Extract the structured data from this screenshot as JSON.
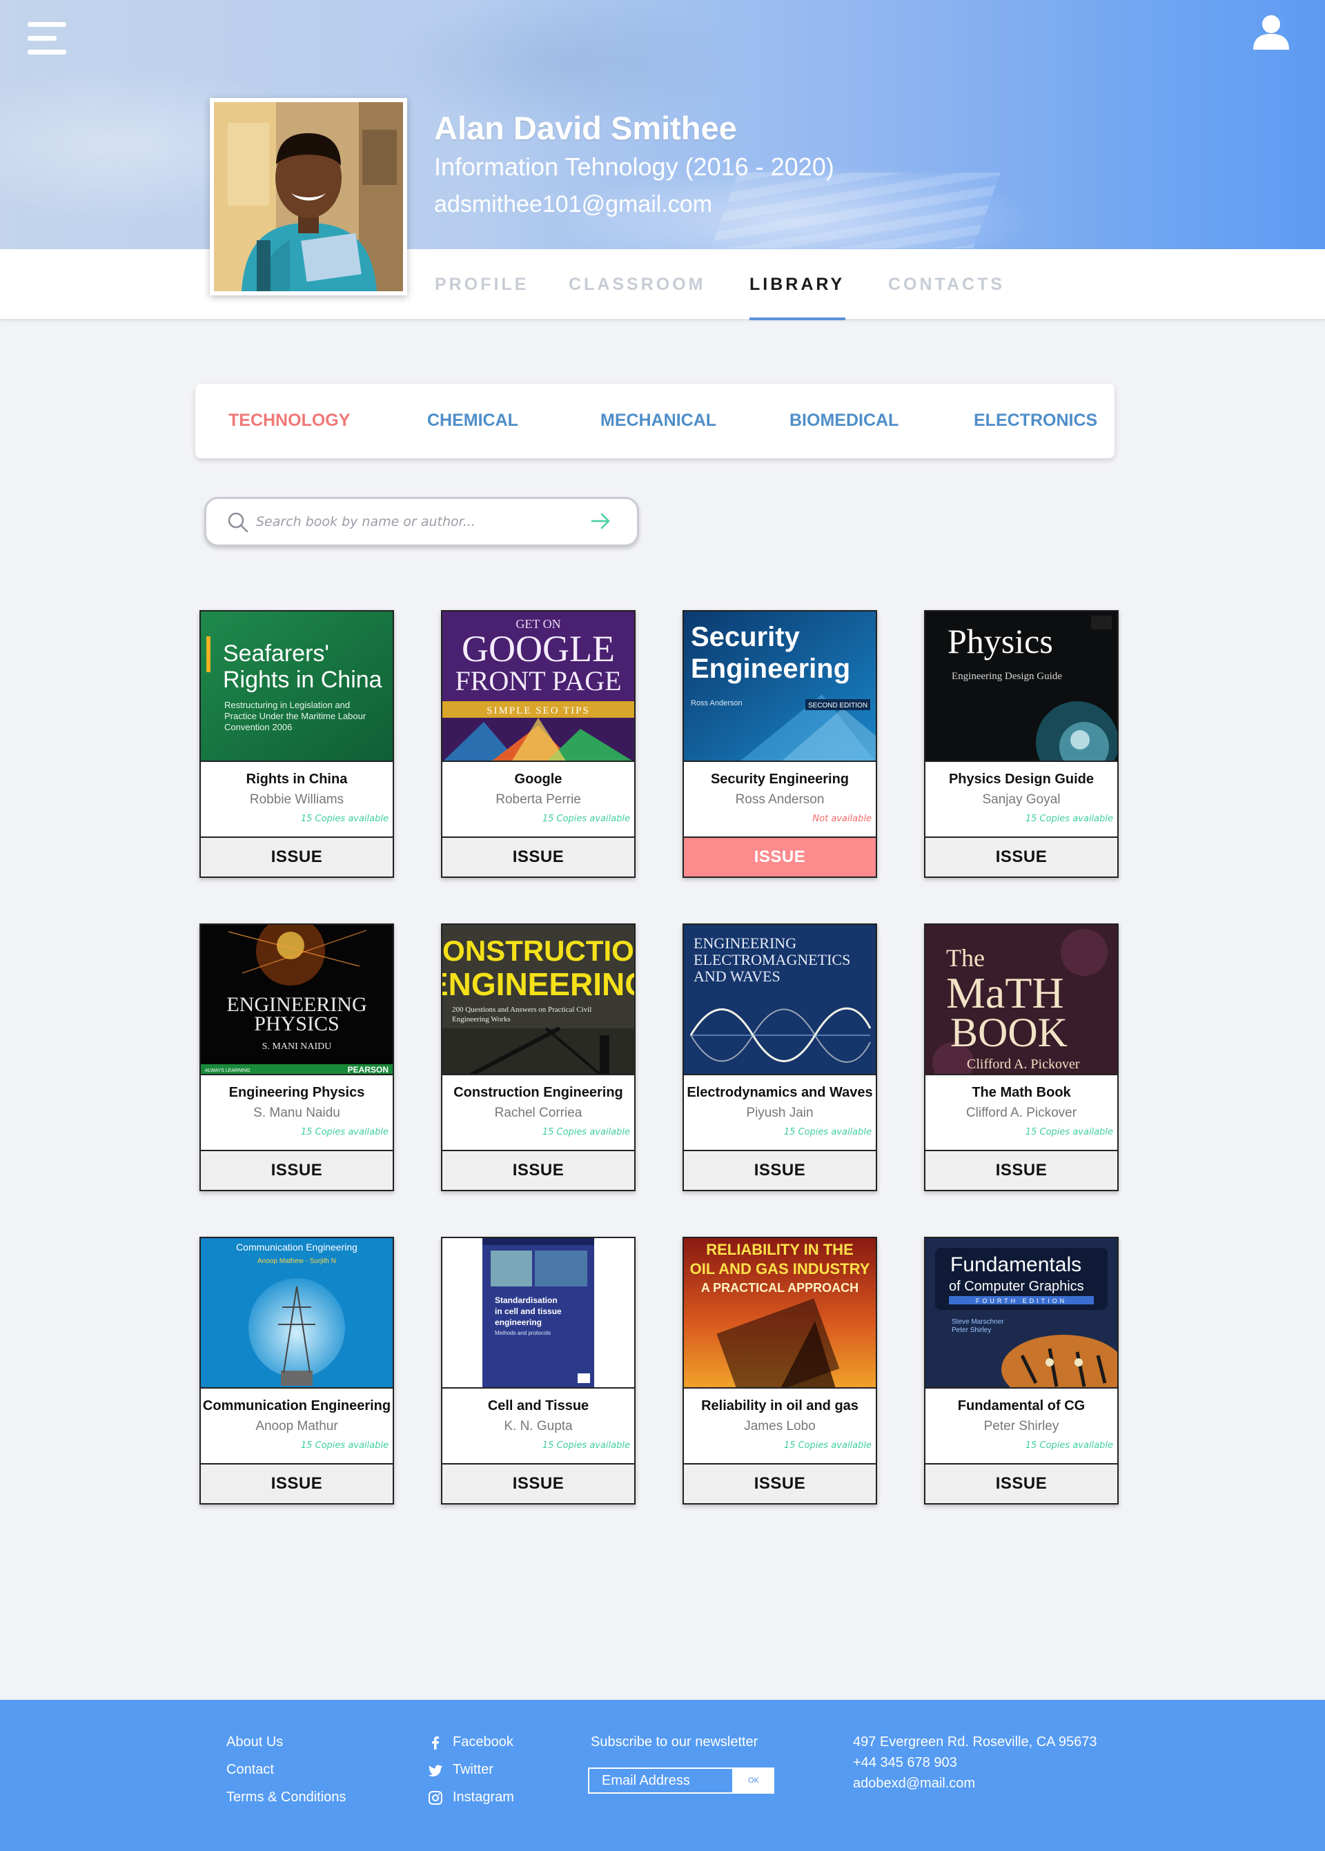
{
  "profile": {
    "name": "Alan David Smithee",
    "course": "Information Tehnology (2016 - 2020)",
    "email": "adsmithee101@gmail.com"
  },
  "tabs": [
    {
      "label": "PROFILE",
      "active": false
    },
    {
      "label": "CLASSROOM",
      "active": false
    },
    {
      "label": "LIBRARY",
      "active": true
    },
    {
      "label": "CONTACTS",
      "active": false
    }
  ],
  "categories": [
    {
      "label": "TECHNOLOGY",
      "active": true
    },
    {
      "label": "CHEMICAL",
      "active": false
    },
    {
      "label": "MECHANICAL",
      "active": false
    },
    {
      "label": "BIOMEDICAL",
      "active": false
    },
    {
      "label": "ELECTRONICS",
      "active": false
    }
  ],
  "search": {
    "placeholder": "Search book by name or author..."
  },
  "books": [
    {
      "title": "Rights in China",
      "author": "Robbie Williams",
      "availability": "15 Copies available",
      "available": true,
      "issue_label": "ISSUE",
      "cover": {
        "lines": [
          "Seafarers'",
          "Rights in China"
        ],
        "sub": [
          "Restructuring in Legislation and",
          "Practice Under the Maritime Labour",
          "Convention 2006"
        ]
      }
    },
    {
      "title": "Google",
      "author": "Roberta Perrie",
      "availability": "15 Copies available",
      "available": true,
      "issue_label": "ISSUE",
      "cover": {
        "top": "GET ON",
        "lines": [
          "GOOGLE",
          "FRONT PAGE"
        ],
        "band": "SIMPLE SEO TIPS"
      }
    },
    {
      "title": "Security Engineering",
      "author": "Ross Anderson",
      "availability": "Not available",
      "available": false,
      "issue_label": "ISSUE",
      "cover": {
        "lines": [
          "Security",
          "Engineering"
        ],
        "author": "Ross Anderson",
        "edition": "SECOND EDITION"
      }
    },
    {
      "title": "Physics Design Guide",
      "author": "Sanjay Goyal",
      "availability": "15 Copies available",
      "available": true,
      "issue_label": "ISSUE",
      "cover": {
        "lines": [
          "Physics"
        ],
        "sub": "Engineering Design Guide"
      }
    },
    {
      "title": "Engineering Physics",
      "author": "S. Manu Naidu",
      "availability": "15 Copies available",
      "available": true,
      "issue_label": "ISSUE",
      "cover": {
        "lines": [
          "ENGINEERING",
          "PHYSICS"
        ],
        "author": "S. MANI NAIDU",
        "publisher": "PEARSON",
        "tag": "ALWAYS LEARNING"
      }
    },
    {
      "title": "Construction Engineering",
      "author": "Rachel Corriea",
      "availability": "15 Copies available",
      "available": true,
      "issue_label": "ISSUE",
      "cover": {
        "lines": [
          "CONSTRUCTION",
          "ENGINEERING"
        ],
        "sub": [
          "200 Questions and Answers on Practical Civil",
          "Engineering Works"
        ]
      }
    },
    {
      "title": "Electrodynamics and Waves",
      "author": "Piyush Jain",
      "availability": "15 Copies available",
      "available": true,
      "issue_label": "ISSUE",
      "cover": {
        "lines": [
          "ENGINEERING",
          "ELECTROMAGNETICS",
          "AND WAVES"
        ]
      }
    },
    {
      "title": "The Math Book",
      "author": "Clifford A. Pickover",
      "availability": "15 Copies available",
      "available": true,
      "issue_label": "ISSUE",
      "cover": {
        "lines": [
          "The",
          "MaTH",
          "BOOK"
        ],
        "author": "Clifford A. Pickover"
      }
    },
    {
      "title": "Communication Engineering",
      "author": "Anoop Mathur",
      "availability": "15 Copies available",
      "available": true,
      "issue_label": "ISSUE",
      "cover": {
        "lines": [
          "Communication Engineering"
        ],
        "author": "Anoop Mathew - Surjith N"
      }
    },
    {
      "title": "Cell and Tissue",
      "author": "K. N. Gupta",
      "availability": "15 Copies available",
      "available": true,
      "issue_label": "ISSUE",
      "cover": {
        "lines": [
          "Standardisation",
          "in cell and tissue",
          "engineering"
        ],
        "sub": "Methods and protocols"
      }
    },
    {
      "title": "Reliability in oil and gas",
      "author": "James Lobo",
      "availability": "15 Copies available",
      "available": true,
      "issue_label": "ISSUE",
      "cover": {
        "lines": [
          "RELIABILITY IN THE",
          "OIL AND GAS INDUSTRY",
          "A PRACTICAL APPROACH"
        ]
      }
    },
    {
      "title": "Fundamental of CG",
      "author": "Peter Shirley",
      "availability": "15 Copies available",
      "available": true,
      "issue_label": "ISSUE",
      "cover": {
        "lines": [
          "Fundamentals",
          "of Computer Graphics"
        ],
        "edition": "FOURTH EDITION",
        "authors": [
          "Steve Marschner",
          "Peter Shirley"
        ]
      }
    }
  ],
  "footer": {
    "links": [
      "About Us",
      "Contact",
      "Terms & Conditions"
    ],
    "social": [
      {
        "label": "Facebook",
        "icon": "facebook-icon"
      },
      {
        "label": "Twitter",
        "icon": "twitter-icon"
      },
      {
        "label": "Instagram",
        "icon": "instagram-icon"
      }
    ],
    "newsletter_label": "Subscribe to our newsletter",
    "newsletter_placeholder": "Email Address",
    "newsletter_button": "OK",
    "address": [
      "497 Evergreen Rd. Roseville, CA 95673",
      "+44 345 678 903",
      "adobexd@mail.com"
    ]
  },
  "colors": {
    "accent": "#4f8ec9",
    "active_category": "#f07878",
    "available": "#3fcf9a",
    "unavailable": "#fd8b8d",
    "footer": "#559bf2"
  }
}
